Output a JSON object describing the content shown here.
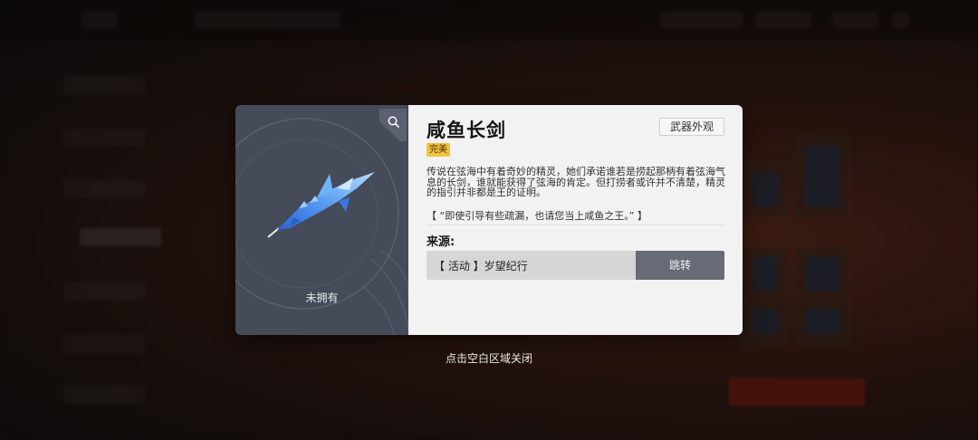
{
  "modal": {
    "title": "咸鱼长剑",
    "skin_button": "武器外观",
    "quality_badge": "完美",
    "description": "传说在弦海中有着奇妙的精灵，她们承诺谁若是捞起那柄有着弦海气息的长剑，谁就能获得了弦海的肯定。但打捞者或许并不清楚，精灵的指引并非都是王的证明。",
    "quote": "【 “即使引导有些疏漏，也请您当上咸鱼之王。” 】",
    "source_label": "来源:",
    "source_item": "【 活动 】岁望纪行",
    "jump_button": "跳转",
    "ownership_status": "未拥有"
  },
  "icons": {
    "zoom": "magnifier-icon",
    "weapon": "salted-fish-sword-image"
  },
  "close_hint": "点击空白区域关闭",
  "colors": {
    "badge_bg": "#f3c23f",
    "jump_button_bg": "#666b76",
    "preview_bg": "#454b59",
    "info_bg": "#f2f2f2"
  }
}
